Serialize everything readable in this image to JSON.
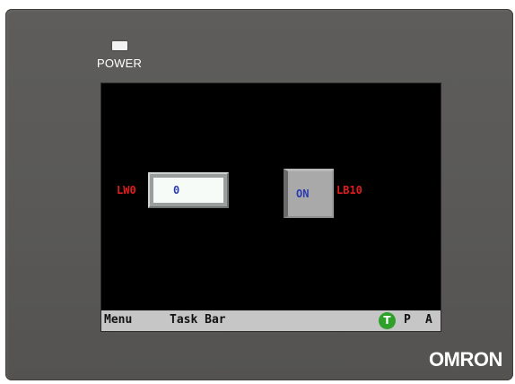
{
  "device": {
    "power_label": "POWER",
    "brand": "OMRON"
  },
  "screen": {
    "word_address_label": "LW0",
    "numeric_value": "0",
    "toggle_state_label": "ON",
    "bit_address_label": "LB10"
  },
  "taskbar": {
    "menu_label": "Menu",
    "taskbar_label": "Task Bar",
    "indicator_t": "T",
    "indicator_p": "P",
    "indicator_a": "A"
  },
  "colors": {
    "bezel": "#5a5957",
    "screen_bg": "#000000",
    "address_label": "#e21c1c",
    "value_text": "#2a3bb0",
    "taskbar_bg": "#c6c6c6",
    "t_indicator": "#2fa12b"
  }
}
